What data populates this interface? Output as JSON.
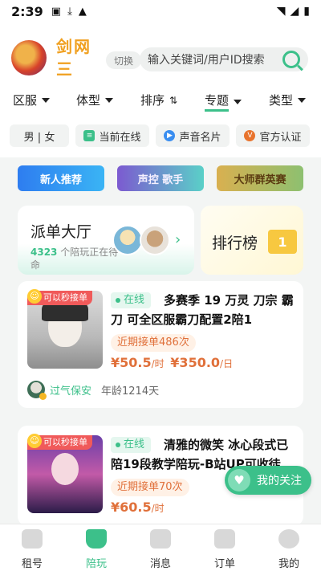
{
  "status_bar": {
    "time": "2:39"
  },
  "header": {
    "game_name": "剑网三",
    "switch_label": "切换",
    "search_placeholder": "输入关键词/用户ID搜索"
  },
  "filters": [
    {
      "label": "区服",
      "kind": "dropdown"
    },
    {
      "label": "体型",
      "kind": "dropdown"
    },
    {
      "label": "排序",
      "kind": "sort"
    },
    {
      "label": "专题",
      "kind": "dropdown",
      "active": true
    },
    {
      "label": "类型",
      "kind": "dropdown"
    }
  ],
  "chips": [
    {
      "label": "男 | 女"
    },
    {
      "label": "当前在线"
    },
    {
      "label": "声音名片"
    },
    {
      "label": "官方认证"
    }
  ],
  "banners": [
    {
      "label": "新人推荐",
      "color": "#2e8cf0"
    },
    {
      "label": "声控 歌手",
      "color": "#8a6ad8"
    },
    {
      "label": "大师群英赛",
      "color": "#c8a040"
    }
  ],
  "hall": {
    "title": "派单大厅",
    "count": "4323",
    "subtitle": "个陪玩正在待命"
  },
  "rank": {
    "title": "排行榜",
    "badge": "1"
  },
  "listings": [
    {
      "tag": "可以秒接单",
      "status": "在线",
      "title": "多赛季 19 万灵 刀宗 霸刀 可全区服霸刀配置2陪1",
      "orders": "近期接单486次",
      "price_hour": "¥50.5",
      "price_hour_unit": "/时",
      "price_day": "¥350.0",
      "price_day_unit": "/日",
      "owner_name": "过气保安",
      "owner_age": "年龄1214天"
    },
    {
      "tag": "可以秒接单",
      "status": "在线",
      "title": "清雅的微笑 冰心段式已陪19段教学陪玩-B站UP可收徒",
      "orders": "近期接单70次",
      "price_hour": "¥60.5",
      "price_hour_unit": "/时"
    }
  ],
  "follow_button": {
    "label": "我的关注"
  },
  "tabbar": [
    {
      "label": "租号",
      "icon": "house-icon"
    },
    {
      "label": "陪玩",
      "icon": "cup-icon",
      "active": true
    },
    {
      "label": "消息",
      "icon": "message-icon"
    },
    {
      "label": "订单",
      "icon": "order-icon"
    },
    {
      "label": "我的",
      "icon": "profile-icon"
    }
  ],
  "colors": {
    "accent": "#3cc08a",
    "price": "#e0703a",
    "tag": "#f05a5a"
  }
}
